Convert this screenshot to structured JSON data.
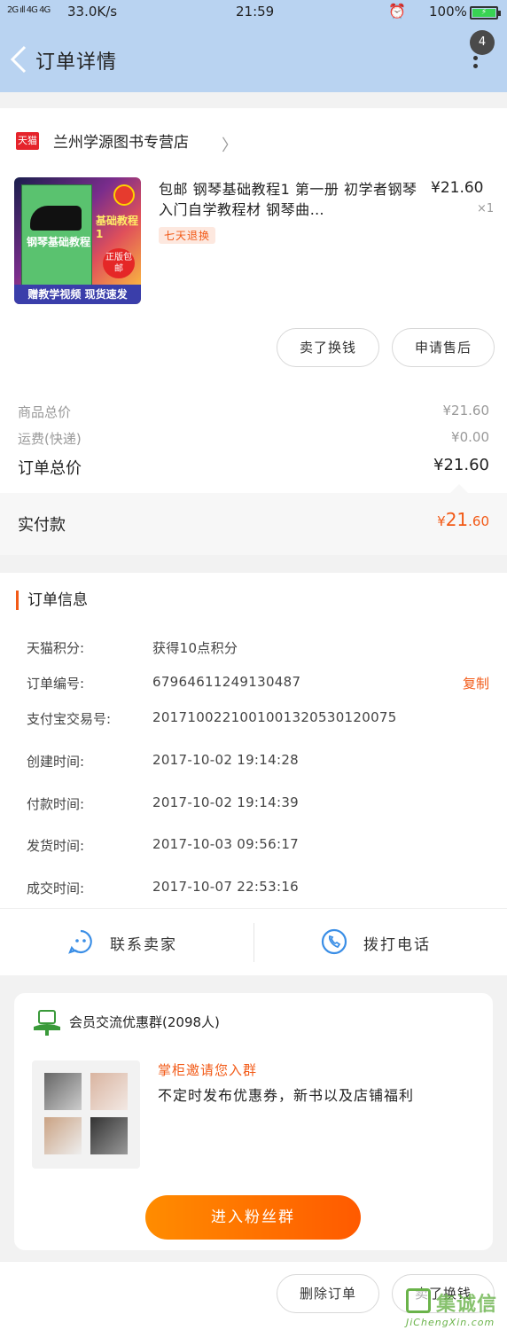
{
  "status_bar": {
    "signal": "2G ıll 4G 4G",
    "network_speed": "33.0K/s",
    "time": "21:59",
    "alarm_icon": "alarm-icon",
    "battery_pct": "100%"
  },
  "header": {
    "title": "订单详情",
    "badge": "4"
  },
  "shop": {
    "platform_logo": "天猫",
    "name": "兰州学源图书专营店"
  },
  "product": {
    "title": "包邮 钢琴基础教程1 第一册 初学者钢琴入门自学教程材 钢琴曲…",
    "price": "¥21.60",
    "quantity": "×1",
    "tag": "七天退换",
    "image_texts": {
      "book_title": "钢琴基础教程",
      "book_title_2": "基础教程1",
      "badge": "正版包邮",
      "bottom": "赠教学视频 现货速发"
    }
  },
  "product_actions": {
    "sell": "卖了换钱",
    "after_sale": "申请售后"
  },
  "summary": {
    "goods_label": "商品总价",
    "goods_value": "¥21.60",
    "shipping_label": "运费(快递)",
    "shipping_value": "¥0.00",
    "total_label": "订单总价",
    "total_value": "¥21.60",
    "paid_label": "实付款",
    "paid_symbol": "¥",
    "paid_int": "21",
    "paid_dec": ".60"
  },
  "order_info": {
    "heading": "订单信息",
    "rows": [
      {
        "key": "天猫积分:",
        "value": "获得10点积分"
      },
      {
        "key": "订单编号:",
        "value": "67964611249130487"
      },
      {
        "key": "支付宝交易号:",
        "value": "2017100221001001320530120075"
      },
      {
        "key": "创建时间:",
        "value": "2017-10-02 19:14:28"
      },
      {
        "key": "付款时间:",
        "value": "2017-10-02 19:14:39"
      },
      {
        "key": "发货时间:",
        "value": "2017-10-03 09:56:17"
      },
      {
        "key": "成交时间:",
        "value": "2017-10-07 22:53:16"
      }
    ],
    "copy": "复制"
  },
  "contact": {
    "seller": "联系卖家",
    "call": "拨打电话"
  },
  "group": {
    "name": "会员交流优惠群(2098人)",
    "invite": "掌柜邀请您入群",
    "description": "不定时发布优惠券，新书以及店铺福利",
    "join": "进入粉丝群"
  },
  "bottom_bar": {
    "delete": "删除订单",
    "sell": "卖了换钱"
  },
  "watermark": {
    "cn": "集诚信",
    "en": "JiChengXin.com"
  },
  "colors": {
    "accent": "#f25a17",
    "header_bg": "#b9d3f1",
    "icon_blue": "#3a8ee6"
  }
}
